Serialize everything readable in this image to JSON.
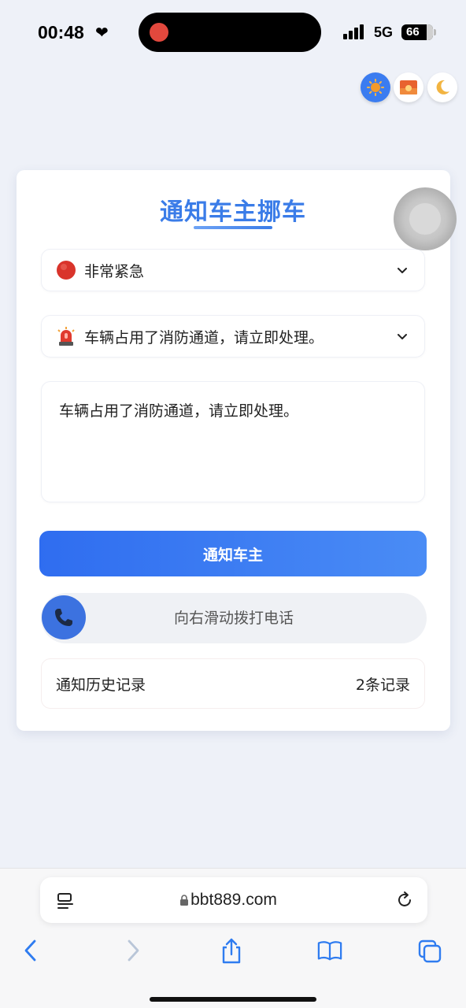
{
  "status_bar": {
    "time": "00:48",
    "network": "5G",
    "battery": "66"
  },
  "theme_buttons": {
    "icons": [
      "sun-icon",
      "sunset-icon",
      "moon-icon"
    ],
    "active": "sun"
  },
  "form": {
    "title": "通知车主挪车",
    "urgency": {
      "icon": "red-circle-icon",
      "selected": "非常紧急"
    },
    "reason": {
      "icon": "siren-icon",
      "selected": "车辆占用了消防通道，请立即处理。"
    },
    "message": {
      "value": "车辆占用了消防通道，请立即处理。"
    },
    "notify_button": "通知车主",
    "slider_text": "向右滑动拨打电话",
    "history": {
      "label": "通知历史记录",
      "count": "2条记录"
    }
  },
  "browser": {
    "url": "bbt889.com"
  },
  "colors": {
    "accent": "#3a7ce8",
    "button": "#2f6df0",
    "background": "#eef1f8"
  }
}
